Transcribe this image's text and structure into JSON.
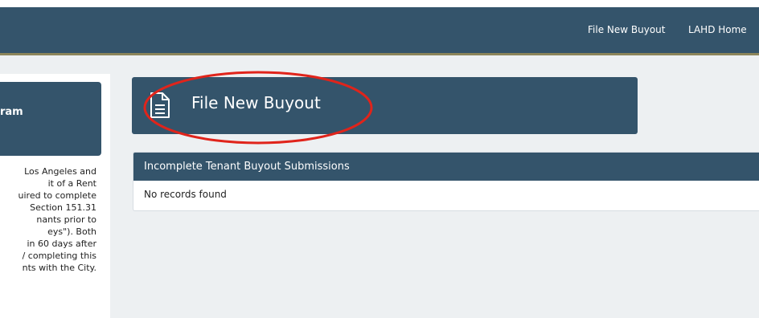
{
  "nav": {
    "links": [
      {
        "label": "File New Buyout"
      },
      {
        "label": "LAHD Home"
      }
    ]
  },
  "left_card": {
    "title": "ram",
    "body_lines": [
      "Los Angeles and",
      "it of a Rent",
      "uired to complete",
      "Section 151.31",
      "nants prior to",
      "eys\"). Both",
      "in 60 days after",
      "/ completing this",
      "nts with the City."
    ]
  },
  "buyout_card": {
    "title": "File New Buyout",
    "icon": "document-icon",
    "highlight_color": "#e0241b"
  },
  "incomplete_panel": {
    "title": "Incomplete Tenant Buyout Submissions",
    "empty_message": "No records found"
  },
  "colors": {
    "navbar": "#34546b",
    "navbar_border": "#8c855a",
    "page_bg": "#edf0f2"
  }
}
